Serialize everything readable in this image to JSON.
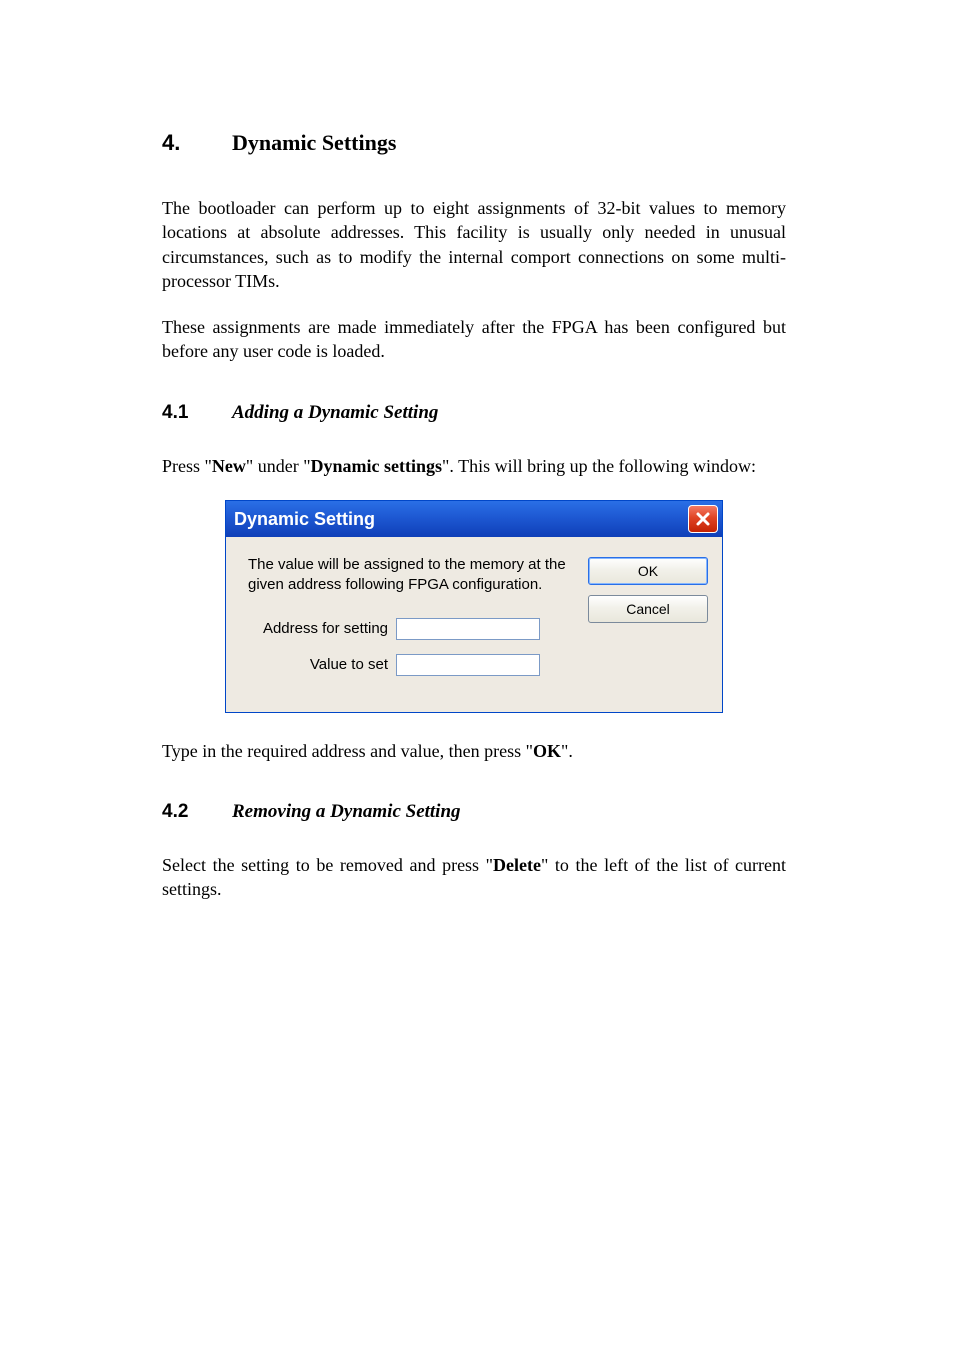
{
  "h1": {
    "num": "4.",
    "title": "Dynamic Settings"
  },
  "para1": "The bootloader can perform up to eight assignments of 32-bit values to memory locations at absolute addresses. This facility is usually only needed in unusual circumstances, such as to modify the internal comport connections on some multi-processor TIMs.",
  "para2": "These assignments are made immediately after the FPGA has been configured but before any user code is loaded.",
  "h2a": {
    "num": "4.1",
    "title": "Adding a Dynamic Setting"
  },
  "para3": {
    "pre1": "Press \"",
    "b1": "New",
    "mid1": "\" under \"",
    "b2": "Dynamic settings",
    "post1": "\". This will bring up the following window:"
  },
  "dialog": {
    "title": "Dynamic Setting",
    "close_icon": "close",
    "desc": "The value will be assigned to the memory at the given address following FPGA configuration.",
    "address_label": "Address for setting",
    "value_label": "Value to set",
    "address_value": "",
    "value_value": "",
    "ok_label": "OK",
    "cancel_label": "Cancel"
  },
  "para4": {
    "pre": "Type in the required address and value, then press \"",
    "b": "OK",
    "post": "\"."
  },
  "h2b": {
    "num": "4.2",
    "title": "Removing a Dynamic Setting"
  },
  "para5": {
    "pre": "Select the setting to be removed and press \"",
    "b": "Delete",
    "post": "\" to the left of the list of current settings."
  }
}
